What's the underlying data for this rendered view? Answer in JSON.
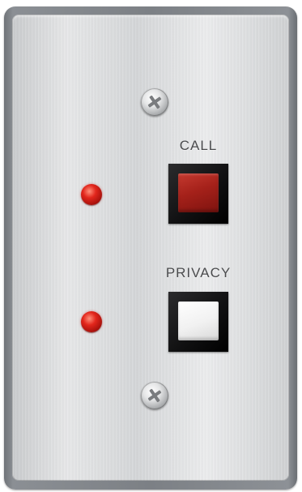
{
  "panel": {
    "call": {
      "label": "CALL",
      "button_color": "#a5211a",
      "led_color": "#e2261c"
    },
    "privacy": {
      "label": "PRIVACY",
      "button_color": "#f1f1f1",
      "led_color": "#e2261c"
    },
    "screws": [
      "phillips-screw-icon",
      "phillips-screw-icon"
    ]
  }
}
